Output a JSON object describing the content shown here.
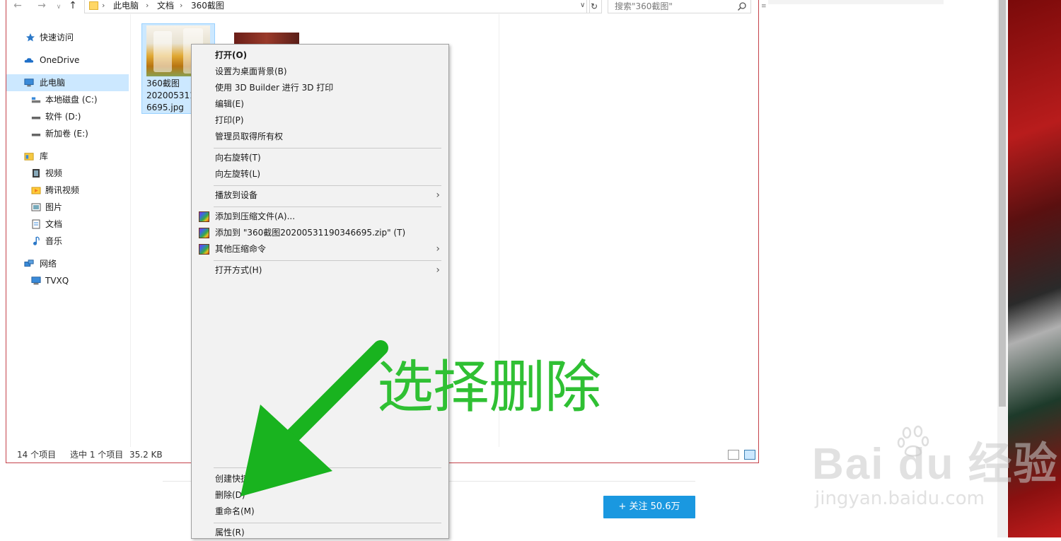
{
  "explorer": {
    "breadcrumb": [
      "此电脑",
      "文档",
      "360截图"
    ],
    "search_placeholder": "搜索\"360截图\"",
    "nav_items": [
      {
        "label": "快速访问",
        "icon": "star-icon"
      },
      {
        "label": "OneDrive",
        "icon": "cloud-icon"
      },
      {
        "label": "此电脑",
        "icon": "computer-icon",
        "selected": true
      },
      {
        "label": "本地磁盘 (C:)",
        "icon": "drive-icon"
      },
      {
        "label": "软件 (D:)",
        "icon": "drive-icon"
      },
      {
        "label": "新加卷 (E:)",
        "icon": "drive-icon"
      },
      {
        "label": "库",
        "icon": "library-icon"
      },
      {
        "label": "视频",
        "icon": "video-icon"
      },
      {
        "label": "腾讯视频",
        "icon": "folder-icon"
      },
      {
        "label": "图片",
        "icon": "picture-icon"
      },
      {
        "label": "文档",
        "icon": "document-icon"
      },
      {
        "label": "音乐",
        "icon": "music-icon"
      },
      {
        "label": "网络",
        "icon": "network-icon"
      },
      {
        "label": "TVXQ",
        "icon": "monitor-icon"
      }
    ],
    "file": {
      "name_lines": [
        "360截图",
        "2020053119",
        "6695.jpg"
      ]
    },
    "status": {
      "item_count": "14 个项目",
      "selected": "选中 1 个项目",
      "size": "35.2 KB"
    }
  },
  "context_menu": {
    "items": [
      {
        "label": "打开(O)",
        "bold": true
      },
      {
        "label": "设置为桌面背景(B)"
      },
      {
        "label": "使用 3D Builder 进行 3D 打印"
      },
      {
        "label": "编辑(E)"
      },
      {
        "label": "打印(P)"
      },
      {
        "label": "管理员取得所有权"
      },
      {
        "label": "向右旋转(T)"
      },
      {
        "label": "向左旋转(L)"
      },
      {
        "label": "播放到设备",
        "submenu": true
      },
      {
        "label": "添加到压缩文件(A)...",
        "icon": "winrar-icon"
      },
      {
        "label": "添加到 \"360截图20200531190346695.zip\" (T)",
        "icon": "winrar-icon"
      },
      {
        "label": "其他压缩命令",
        "icon": "winrar-icon",
        "submenu": true
      },
      {
        "label": "打开方式(H)",
        "submenu": true
      },
      {
        "label": "创建快捷方式(S)"
      },
      {
        "label": "删除(D)"
      },
      {
        "label": "重命名(M)"
      },
      {
        "label": "属性(R)"
      }
    ]
  },
  "annotation": {
    "text": "选择删除",
    "color": "#2fc033"
  },
  "background_page": {
    "follow_button": "+ 关注  50.6万",
    "watermark_logo": "Bai du 经验",
    "watermark_url": "jingyan.baidu.com"
  }
}
